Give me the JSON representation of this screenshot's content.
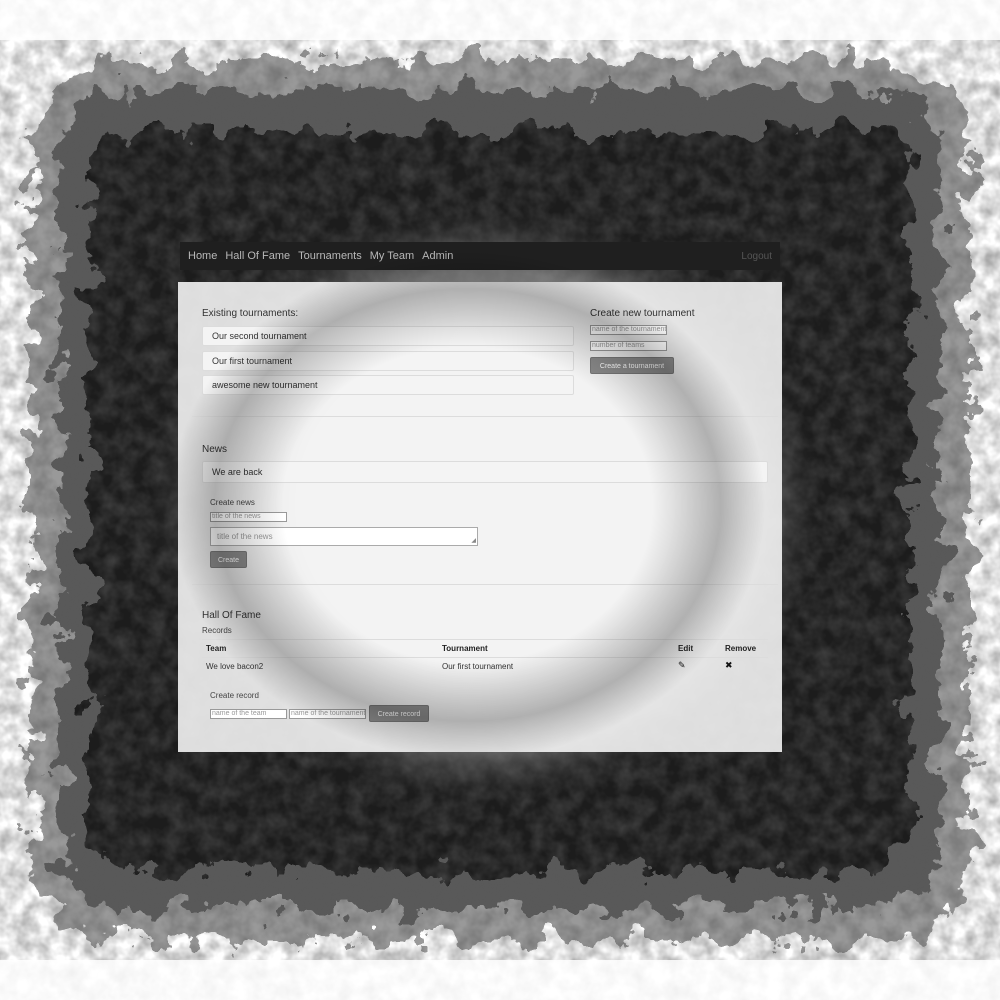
{
  "nav": {
    "items": [
      "Home",
      "Hall Of Fame",
      "Tournaments",
      "My Team",
      "Admin"
    ],
    "right_text": "Logout"
  },
  "tournaments": {
    "heading": "Existing tournaments:",
    "items": [
      "Our second tournament",
      "Our first tournament",
      "awesome new tournament"
    ],
    "create_heading": "Create new tournament",
    "name_placeholder": "name of the tournament",
    "teams_placeholder": "number of teams",
    "create_button": "Create a tournament"
  },
  "news": {
    "heading": "News",
    "items": [
      "We are back"
    ],
    "create_label": "Create news",
    "title_placeholder": "title of the news",
    "body_placeholder": "title of the news",
    "create_button": "Create"
  },
  "hall_of_fame": {
    "heading": "Hall Of Fame",
    "subheading": "Records",
    "columns": [
      "Team",
      "Tournament",
      "Edit",
      "Remove"
    ],
    "rows": [
      {
        "team": "We love bacon2",
        "tournament": "Our first tournament"
      }
    ],
    "create_label": "Create record",
    "team_placeholder": "name of the team",
    "tournament_placeholder": "name of the tournament",
    "create_button": "Create record"
  },
  "colors": {
    "navbar": "#1f1f1f",
    "button": "#8a8a8a",
    "background": "#f4f4f4"
  }
}
